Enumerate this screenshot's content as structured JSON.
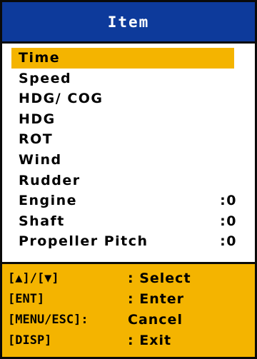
{
  "title": "Item",
  "menu": {
    "items": [
      {
        "label": "Time",
        "value": "",
        "selected": true
      },
      {
        "label": "Speed",
        "value": "",
        "selected": false
      },
      {
        "label": "HDG/ COG",
        "value": "",
        "selected": false
      },
      {
        "label": "HDG",
        "value": "",
        "selected": false
      },
      {
        "label": "ROT",
        "value": "",
        "selected": false
      },
      {
        "label": "Wind",
        "value": "",
        "selected": false
      },
      {
        "label": "Rudder",
        "value": "",
        "selected": false
      },
      {
        "label": "Engine",
        "value": ":0",
        "selected": false
      },
      {
        "label": "Shaft",
        "value": ":0",
        "selected": false
      },
      {
        "label": "Propeller Pitch",
        "value": ":0",
        "selected": false
      }
    ]
  },
  "footer": {
    "hints": [
      {
        "key": "[▲]/[▼]",
        "action": ":  Select"
      },
      {
        "key": "[ENT]",
        "action": ":  Enter"
      },
      {
        "key": "[MENU/ESC]:",
        "action": "   Cancel"
      },
      {
        "key": "[DISP]",
        "action": ":  Exit"
      }
    ]
  },
  "colors": {
    "title_bg": "#0d3a9b",
    "highlight": "#f4b400",
    "footer_bg": "#f4b400",
    "border": "#0a0a0a"
  }
}
